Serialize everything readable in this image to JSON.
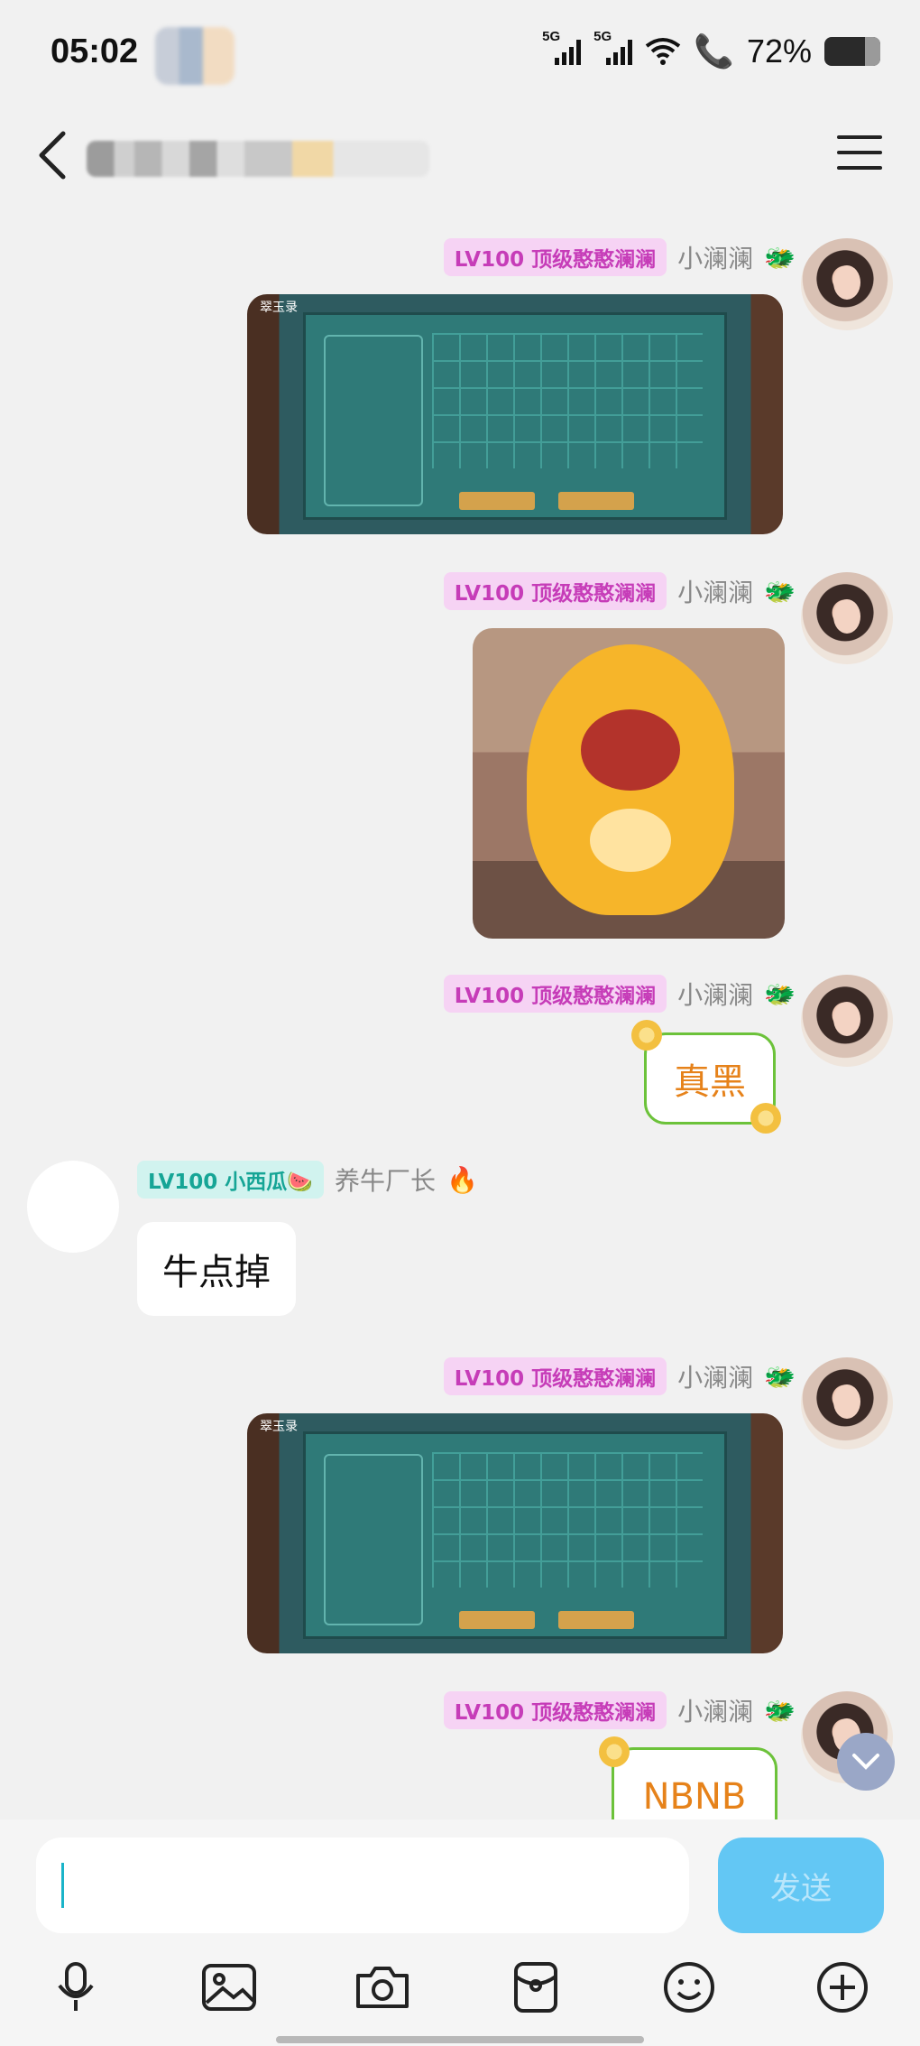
{
  "status_bar": {
    "time": "05:02",
    "signal1_label": "5G",
    "signal2_label": "5G",
    "battery": "72%",
    "battery_level": 0.72
  },
  "messages": [
    {
      "sender": "self",
      "level_tag": "LV100 顶级憨憨澜澜",
      "nickname": "小澜澜",
      "badge": "🐲",
      "type": "image",
      "image": "game screenshot",
      "game_title": "翠玉录"
    },
    {
      "sender": "self",
      "level_tag": "LV100 顶级憨憨澜澜",
      "nickname": "小澜澜",
      "badge": "🐲",
      "type": "image",
      "image": "yellow dinosaur plush sticker"
    },
    {
      "sender": "self",
      "level_tag": "LV100 顶级憨憨澜澜",
      "nickname": "小澜澜",
      "badge": "🐲",
      "type": "text",
      "text": "真黑"
    },
    {
      "sender": "other",
      "level_tag": "LV100 小西瓜🍉",
      "nickname": "养牛厂长",
      "badge": "🔥",
      "type": "text",
      "text": "牛点掉"
    },
    {
      "sender": "self",
      "level_tag": "LV100 顶级憨憨澜澜",
      "nickname": "小澜澜",
      "badge": "🐲",
      "type": "image",
      "image": "game screenshot",
      "game_title": "翠玉录"
    },
    {
      "sender": "self",
      "level_tag": "LV100 顶级憨憨澜澜",
      "nickname": "小澜澜",
      "badge": "🐲",
      "type": "text",
      "text": "NBNB"
    }
  ],
  "input": {
    "placeholder": "",
    "send_label": "发送"
  },
  "toolbar": [
    "microphone-icon",
    "image-icon",
    "camera-icon",
    "red-packet-icon",
    "emoji-icon",
    "plus-icon"
  ],
  "colors": {
    "self_tag_bg": "#f6d3f4",
    "self_tag_fg": "#c63cb8",
    "other_tag_bg": "#d1f3ef",
    "other_tag_fg": "#16a596",
    "send_button": "#63c7f4"
  }
}
